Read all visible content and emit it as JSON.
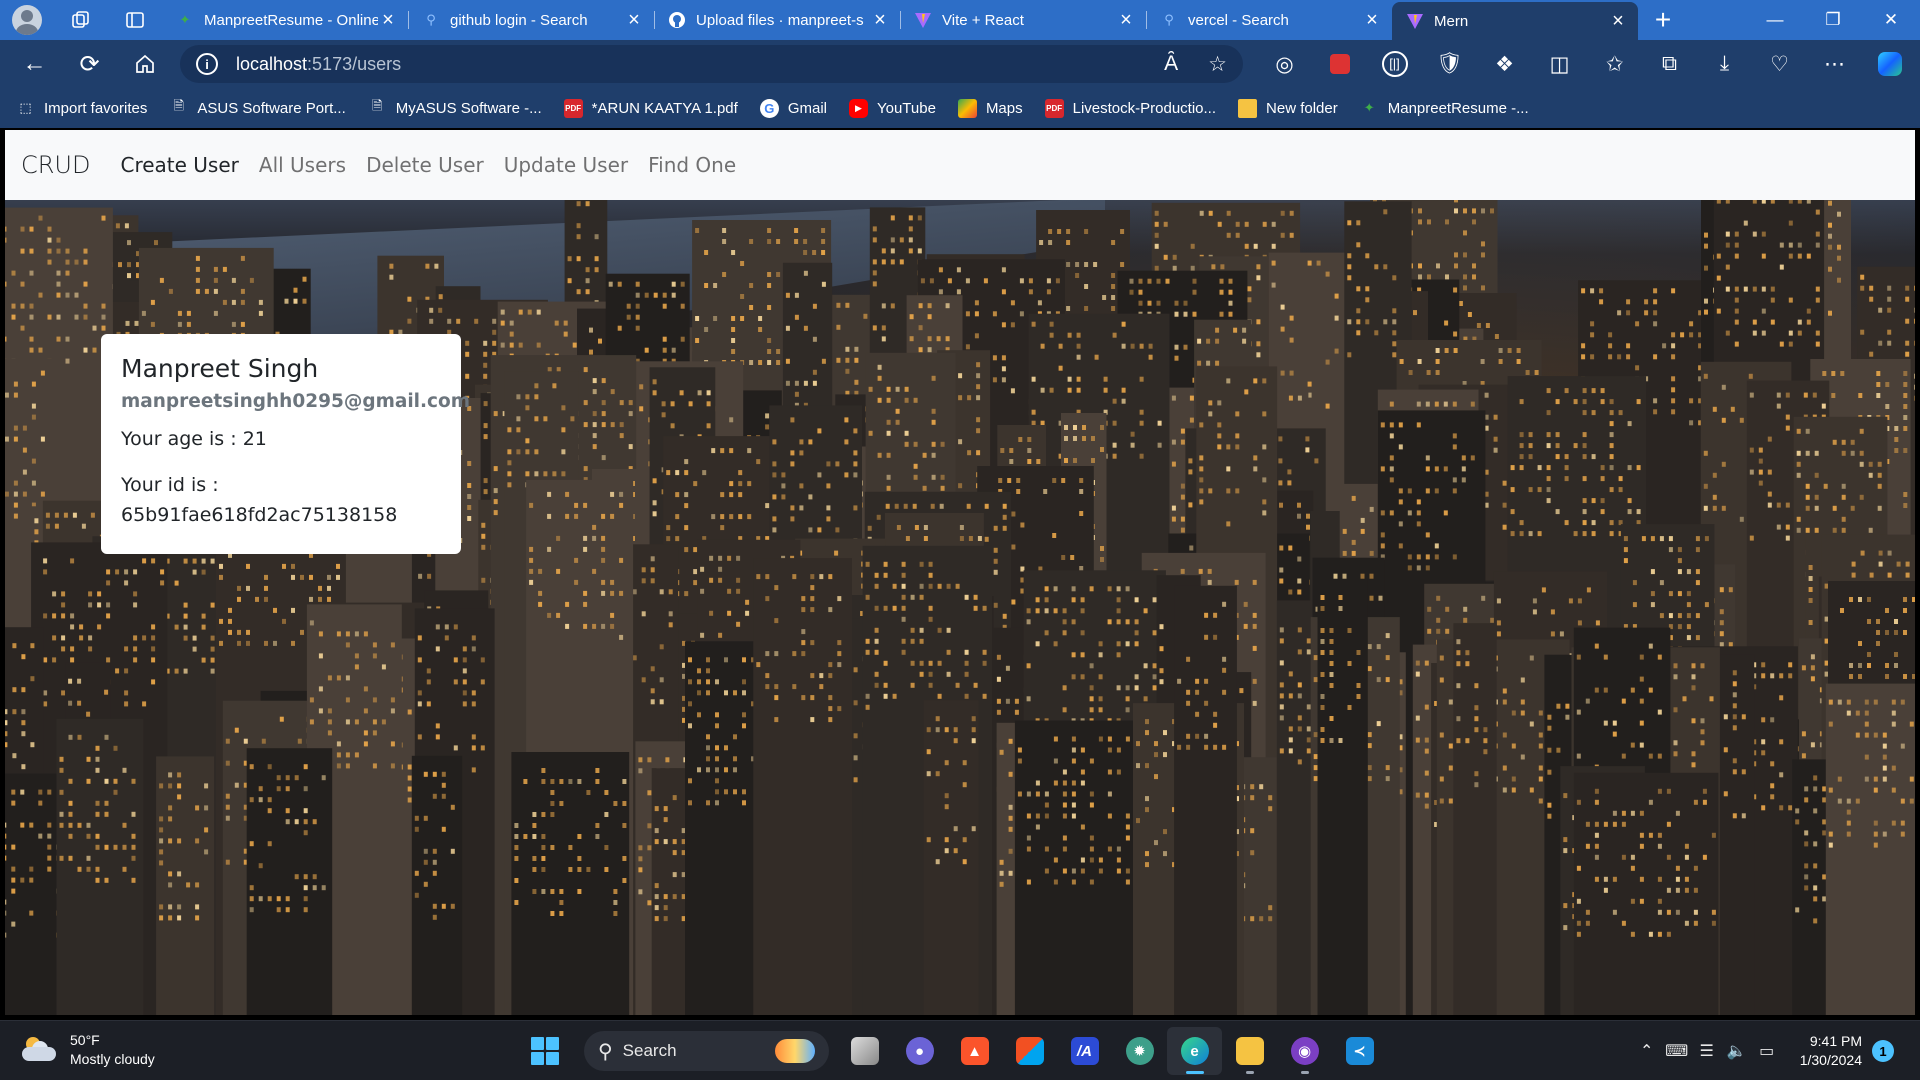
{
  "browser": {
    "tabs": [
      {
        "title": "ManpreetResume - Online",
        "icon": "manpreetresume-favicon",
        "color": "#3fae49"
      },
      {
        "title": "github login - Search",
        "icon": "search-favicon",
        "color": "#4a8de0"
      },
      {
        "title": "Upload files · manpreet-s",
        "icon": "github-favicon",
        "color": "#ffffff"
      },
      {
        "title": "Vite + React",
        "icon": "vite-favicon",
        "color": "#a86bff"
      },
      {
        "title": "vercel - Search",
        "icon": "search-favicon",
        "color": "#4a8de0"
      },
      {
        "title": "Mern",
        "icon": "vite-favicon",
        "color": "#a86bff",
        "active": true
      }
    ],
    "address": {
      "host": "localhost",
      "path": ":5173/users"
    },
    "favorites": [
      {
        "label": "Import favorites",
        "icon": "import-icon"
      },
      {
        "label": "ASUS Software Port...",
        "icon": "page-icon"
      },
      {
        "label": "MyASUS Software -...",
        "icon": "page-icon"
      },
      {
        "label": "*ARUN KAATYA 1.pdf",
        "icon": "pdf-icon"
      },
      {
        "label": "Gmail",
        "icon": "google-icon"
      },
      {
        "label": "YouTube",
        "icon": "youtube-icon"
      },
      {
        "label": "Maps",
        "icon": "maps-icon"
      },
      {
        "label": "Livestock-Productio...",
        "icon": "pdf-icon"
      },
      {
        "label": "New folder",
        "icon": "folder-icon"
      },
      {
        "label": "ManpreetResume -...",
        "icon": "manpreetresume-favicon"
      }
    ]
  },
  "app": {
    "brand": "CRUD",
    "nav": [
      "Create User",
      "All Users",
      "Delete User",
      "Update User",
      "Find One"
    ],
    "active_nav": "Create User",
    "card": {
      "name": "Manpreet Singh",
      "email": "manpreetsinghh0295@gmail.com",
      "age_text": "Your age is : 21",
      "id_label": "Your id is :",
      "id_value": "65b91fae618fd2ac75138158"
    }
  },
  "taskbar": {
    "weather": {
      "temp": "50°F",
      "condition": "Mostly cloudy"
    },
    "search_label": "Search",
    "clock": {
      "time": "9:41 PM",
      "date": "1/30/2024"
    },
    "notification_count": "1"
  },
  "colors": {
    "titlebar": "#2d6ec7",
    "toolbar": "#1f3e6b",
    "navbar": "#f8f9fa",
    "accent": "#4cc2ff"
  }
}
